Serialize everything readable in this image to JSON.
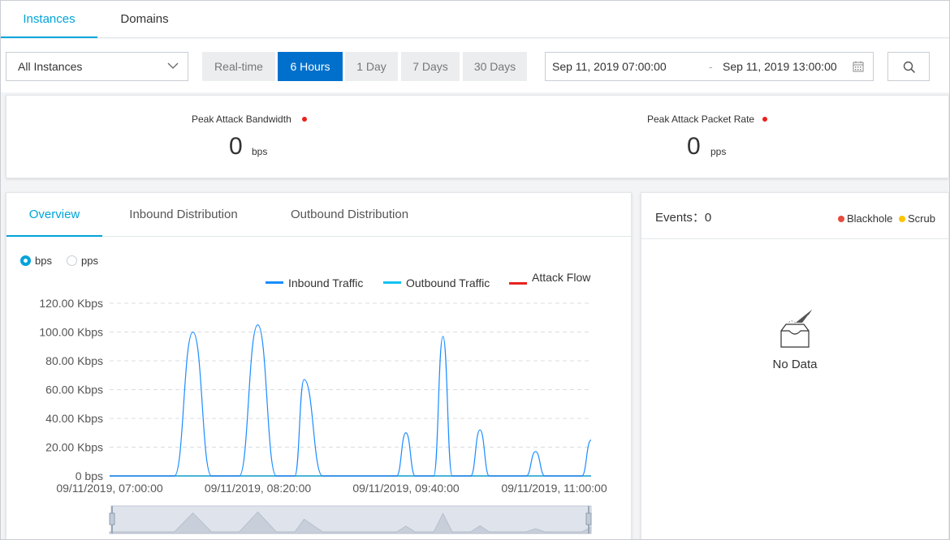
{
  "top_tabs": [
    {
      "label": "Instances",
      "active": true
    },
    {
      "label": "Domains",
      "active": false
    }
  ],
  "toolbar": {
    "instance_select": "All Instances",
    "ranges": [
      {
        "label": "Real-time",
        "active": false
      },
      {
        "label": "6 Hours",
        "active": true
      },
      {
        "label": "1 Day",
        "active": false
      },
      {
        "label": "7 Days",
        "active": false
      },
      {
        "label": "30 Days",
        "active": false
      }
    ],
    "date_start": "Sep 11, 2019 07:00:00",
    "date_sep": "-",
    "date_end": "Sep 11, 2019 13:00:00"
  },
  "stats": {
    "bandwidth": {
      "label": "Peak Attack Bandwidth",
      "value": "0",
      "unit": "bps"
    },
    "packet_rate": {
      "label": "Peak Attack Packet Rate",
      "value": "0",
      "unit": "pps"
    }
  },
  "chart_tabs": [
    {
      "label": "Overview",
      "active": true
    },
    {
      "label": "Inbound Distribution",
      "active": false
    },
    {
      "label": "Outbound Distribution",
      "active": false
    }
  ],
  "unit_toggle": [
    {
      "label": "bps",
      "selected": true
    },
    {
      "label": "pps",
      "selected": false
    }
  ],
  "colors": {
    "accent": "#00a4d9",
    "primary_button": "#0070cc",
    "inbound": "#1a8cff",
    "outbound": "#13c2f2",
    "attack": "#e8221e",
    "scrub": "#ffc300"
  },
  "chart_data": {
    "type": "line",
    "title": "",
    "legend_placement": "top-right",
    "grid": true,
    "xlabel": "",
    "ylabel": "",
    "ylim": [
      0,
      120
    ],
    "y_ticks": [
      "0 bps",
      "20.00 Kbps",
      "40.00 Kbps",
      "60.00 Kbps",
      "80.00 Kbps",
      "100.00 Kbps",
      "120.00 Kbps"
    ],
    "x_tick_labels": [
      "09/11/2019, 07:00:00",
      "09/11/2019, 08:20:00",
      "09/11/2019, 09:40:00",
      "09/11/2019, 11:00:00"
    ],
    "y_unit": "Kbps",
    "series": [
      {
        "name": "Inbound Traffic",
        "points": [
          [
            "07:00",
            0
          ],
          [
            "07:25",
            0
          ],
          [
            "07:35",
            0
          ],
          [
            "07:45",
            100
          ],
          [
            "07:55",
            0
          ],
          [
            "08:05",
            0
          ],
          [
            "08:10",
            0
          ],
          [
            "08:20",
            105
          ],
          [
            "08:30",
            0
          ],
          [
            "08:35",
            0
          ],
          [
            "08:40",
            0
          ],
          [
            "08:45",
            67
          ],
          [
            "08:55",
            0
          ],
          [
            "09:30",
            0
          ],
          [
            "09:35",
            0
          ],
          [
            "09:40",
            30
          ],
          [
            "09:45",
            0
          ],
          [
            "09:50",
            0
          ],
          [
            "09:55",
            0
          ],
          [
            "10:00",
            97
          ],
          [
            "10:05",
            0
          ],
          [
            "10:15",
            0
          ],
          [
            "10:20",
            32
          ],
          [
            "10:25",
            0
          ],
          [
            "10:35",
            0
          ],
          [
            "10:45",
            0
          ],
          [
            "10:50",
            17
          ],
          [
            "10:55",
            0
          ],
          [
            "11:15",
            0
          ],
          [
            "11:20",
            25
          ]
        ]
      },
      {
        "name": "Outbound Traffic",
        "points": [
          [
            "07:00",
            0
          ],
          [
            "11:20",
            0
          ]
        ]
      },
      {
        "name": "Attack Flow",
        "points": [
          [
            "07:00",
            0
          ],
          [
            "11:20",
            0
          ]
        ]
      }
    ]
  },
  "events": {
    "title": "Events：0",
    "legend": [
      {
        "label": "Blackhole",
        "color": "#e84a3c"
      },
      {
        "label": "Scrub",
        "color": "#ffc300"
      }
    ],
    "empty_text": "No Data"
  }
}
